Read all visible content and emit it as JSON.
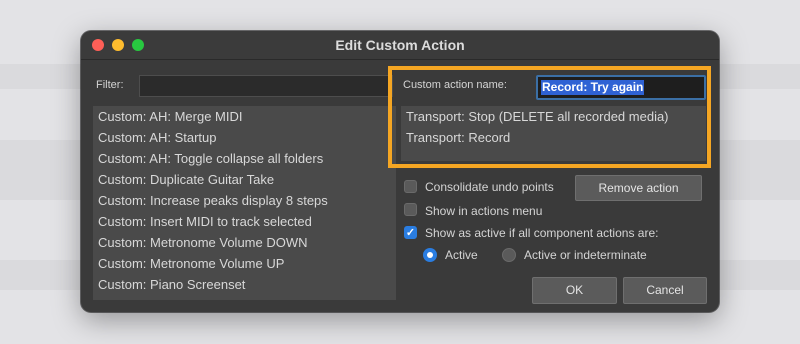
{
  "window": {
    "title": "Edit Custom Action",
    "filter_label": "Filter:",
    "filter_value": ""
  },
  "actions": [
    "Custom: AH: Merge MIDI",
    "Custom: AH: Startup",
    "Custom: AH: Toggle collapse all folders",
    "Custom: Duplicate Guitar Take",
    "Custom: Increase peaks display 8 steps",
    "Custom: Insert MIDI to track selected",
    "Custom: Metronome Volume DOWN",
    "Custom: Metronome Volume UP",
    "Custom: Piano Screenset"
  ],
  "editor": {
    "name_label": "Custom action name:",
    "name_value": "Record: Try again",
    "components": [
      "Transport: Stop (DELETE all recorded media)",
      "Transport: Record"
    ]
  },
  "options": {
    "consolidate_label": "Consolidate undo points",
    "consolidate_checked": false,
    "show_menu_label": "Show in actions menu",
    "show_menu_checked": false,
    "show_active_label": "Show as active if all component actions are:",
    "show_active_checked": true,
    "radio_active_label": "Active",
    "radio_indeterminate_label": "Active or indeterminate",
    "radio_selected": "Active"
  },
  "buttons": {
    "remove": "Remove action",
    "ok": "OK",
    "cancel": "Cancel"
  },
  "colors": {
    "highlight_border": "#f5a623",
    "accent": "#2a7de1",
    "selection": "#2f62d4"
  }
}
